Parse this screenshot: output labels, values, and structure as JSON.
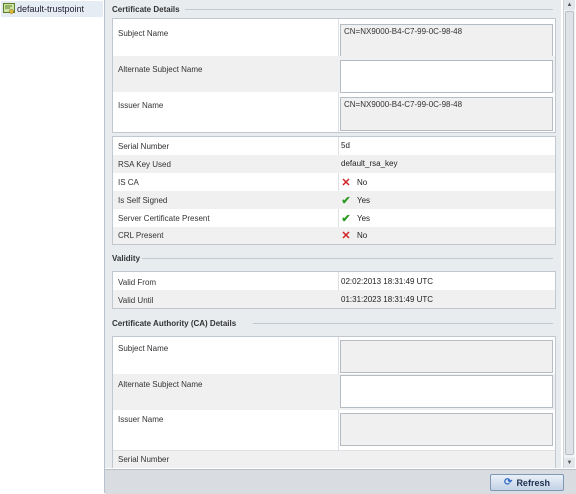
{
  "tree": {
    "item_label": "default-trustpoint"
  },
  "certificate_details": {
    "title": "Certificate Details",
    "subject_name_label": "Subject Name",
    "subject_name_value": "CN=NX9000-B4-C7-99-0C-98-48",
    "alternate_subject_name_label": "Alternate Subject Name",
    "alternate_subject_name_value": "",
    "issuer_name_label": "Issuer Name",
    "issuer_name_value": "CN=NX9000-B4-C7-99-0C-98-48",
    "properties": [
      {
        "label": "Serial Number",
        "value": "5d",
        "icon": ""
      },
      {
        "label": "RSA Key Used",
        "value": "default_rsa_key",
        "icon": ""
      },
      {
        "label": "IS CA",
        "value": "No",
        "icon": "x-icon"
      },
      {
        "label": "Is Self Signed",
        "value": "Yes",
        "icon": "check-icon"
      },
      {
        "label": "Server Certificate Present",
        "value": "Yes",
        "icon": "check-icon"
      },
      {
        "label": "CRL Present",
        "value": "No",
        "icon": "x-icon"
      }
    ]
  },
  "validity": {
    "title": "Validity",
    "rows": [
      {
        "label": "Valid From",
        "value": "02:02:2013 18:31:49 UTC"
      },
      {
        "label": "Valid Until",
        "value": "01:31:2023 18:31:49 UTC"
      }
    ]
  },
  "ca_details": {
    "title": "Certificate Authority (CA) Details",
    "subject_name_label": "Subject Name",
    "subject_name_value": "",
    "alternate_subject_name_label": "Alternate Subject Name",
    "alternate_subject_name_value": "",
    "issuer_name_label": "Issuer Name",
    "issuer_name_value": "",
    "serial_number_label": "Serial Number"
  },
  "footer": {
    "refresh_label": "Refresh"
  },
  "colors": {
    "error_x": "#d0262b",
    "success_check": "#2e9a23",
    "button_border": "#8096b5"
  }
}
